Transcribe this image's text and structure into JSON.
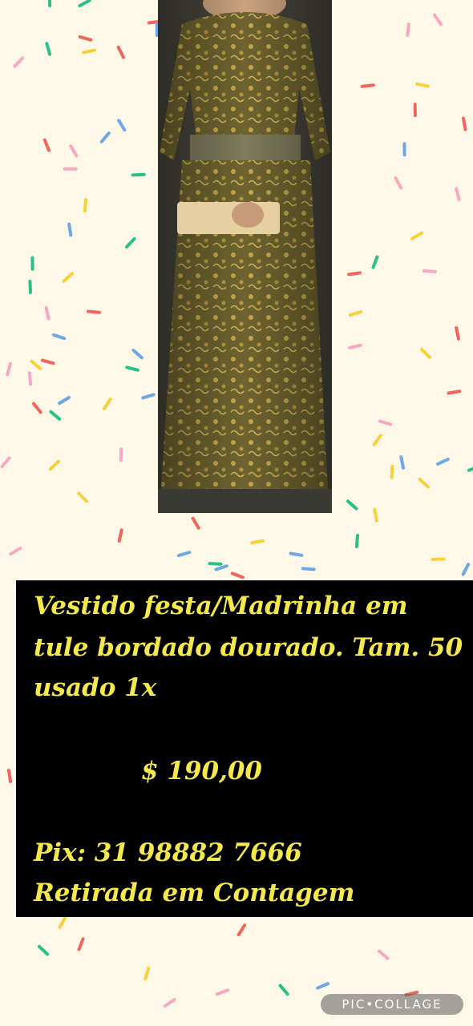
{
  "post": {
    "description_lines": [
      "Vestido festa/Madrinha em",
      "tule bordado dourado. Tam. 50",
      "usado 1x"
    ],
    "price": "$ 190,00",
    "pix": "Pix:   31 98882 7666",
    "pickup": "Retirada em  Contagem"
  },
  "watermark": "PIC•COLLAGE",
  "colors": {
    "background": "#fdf8e8",
    "panel": "#000000",
    "text_accent": "#f4e84a",
    "dress": "#8a7a3a",
    "sprinkles": [
      "#f2655a",
      "#f7a8c4",
      "#6fa8e8",
      "#2bbf8a",
      "#f7d03c"
    ]
  },
  "photo": {
    "subject": "woman-in-gold-lace-dress-photo"
  }
}
